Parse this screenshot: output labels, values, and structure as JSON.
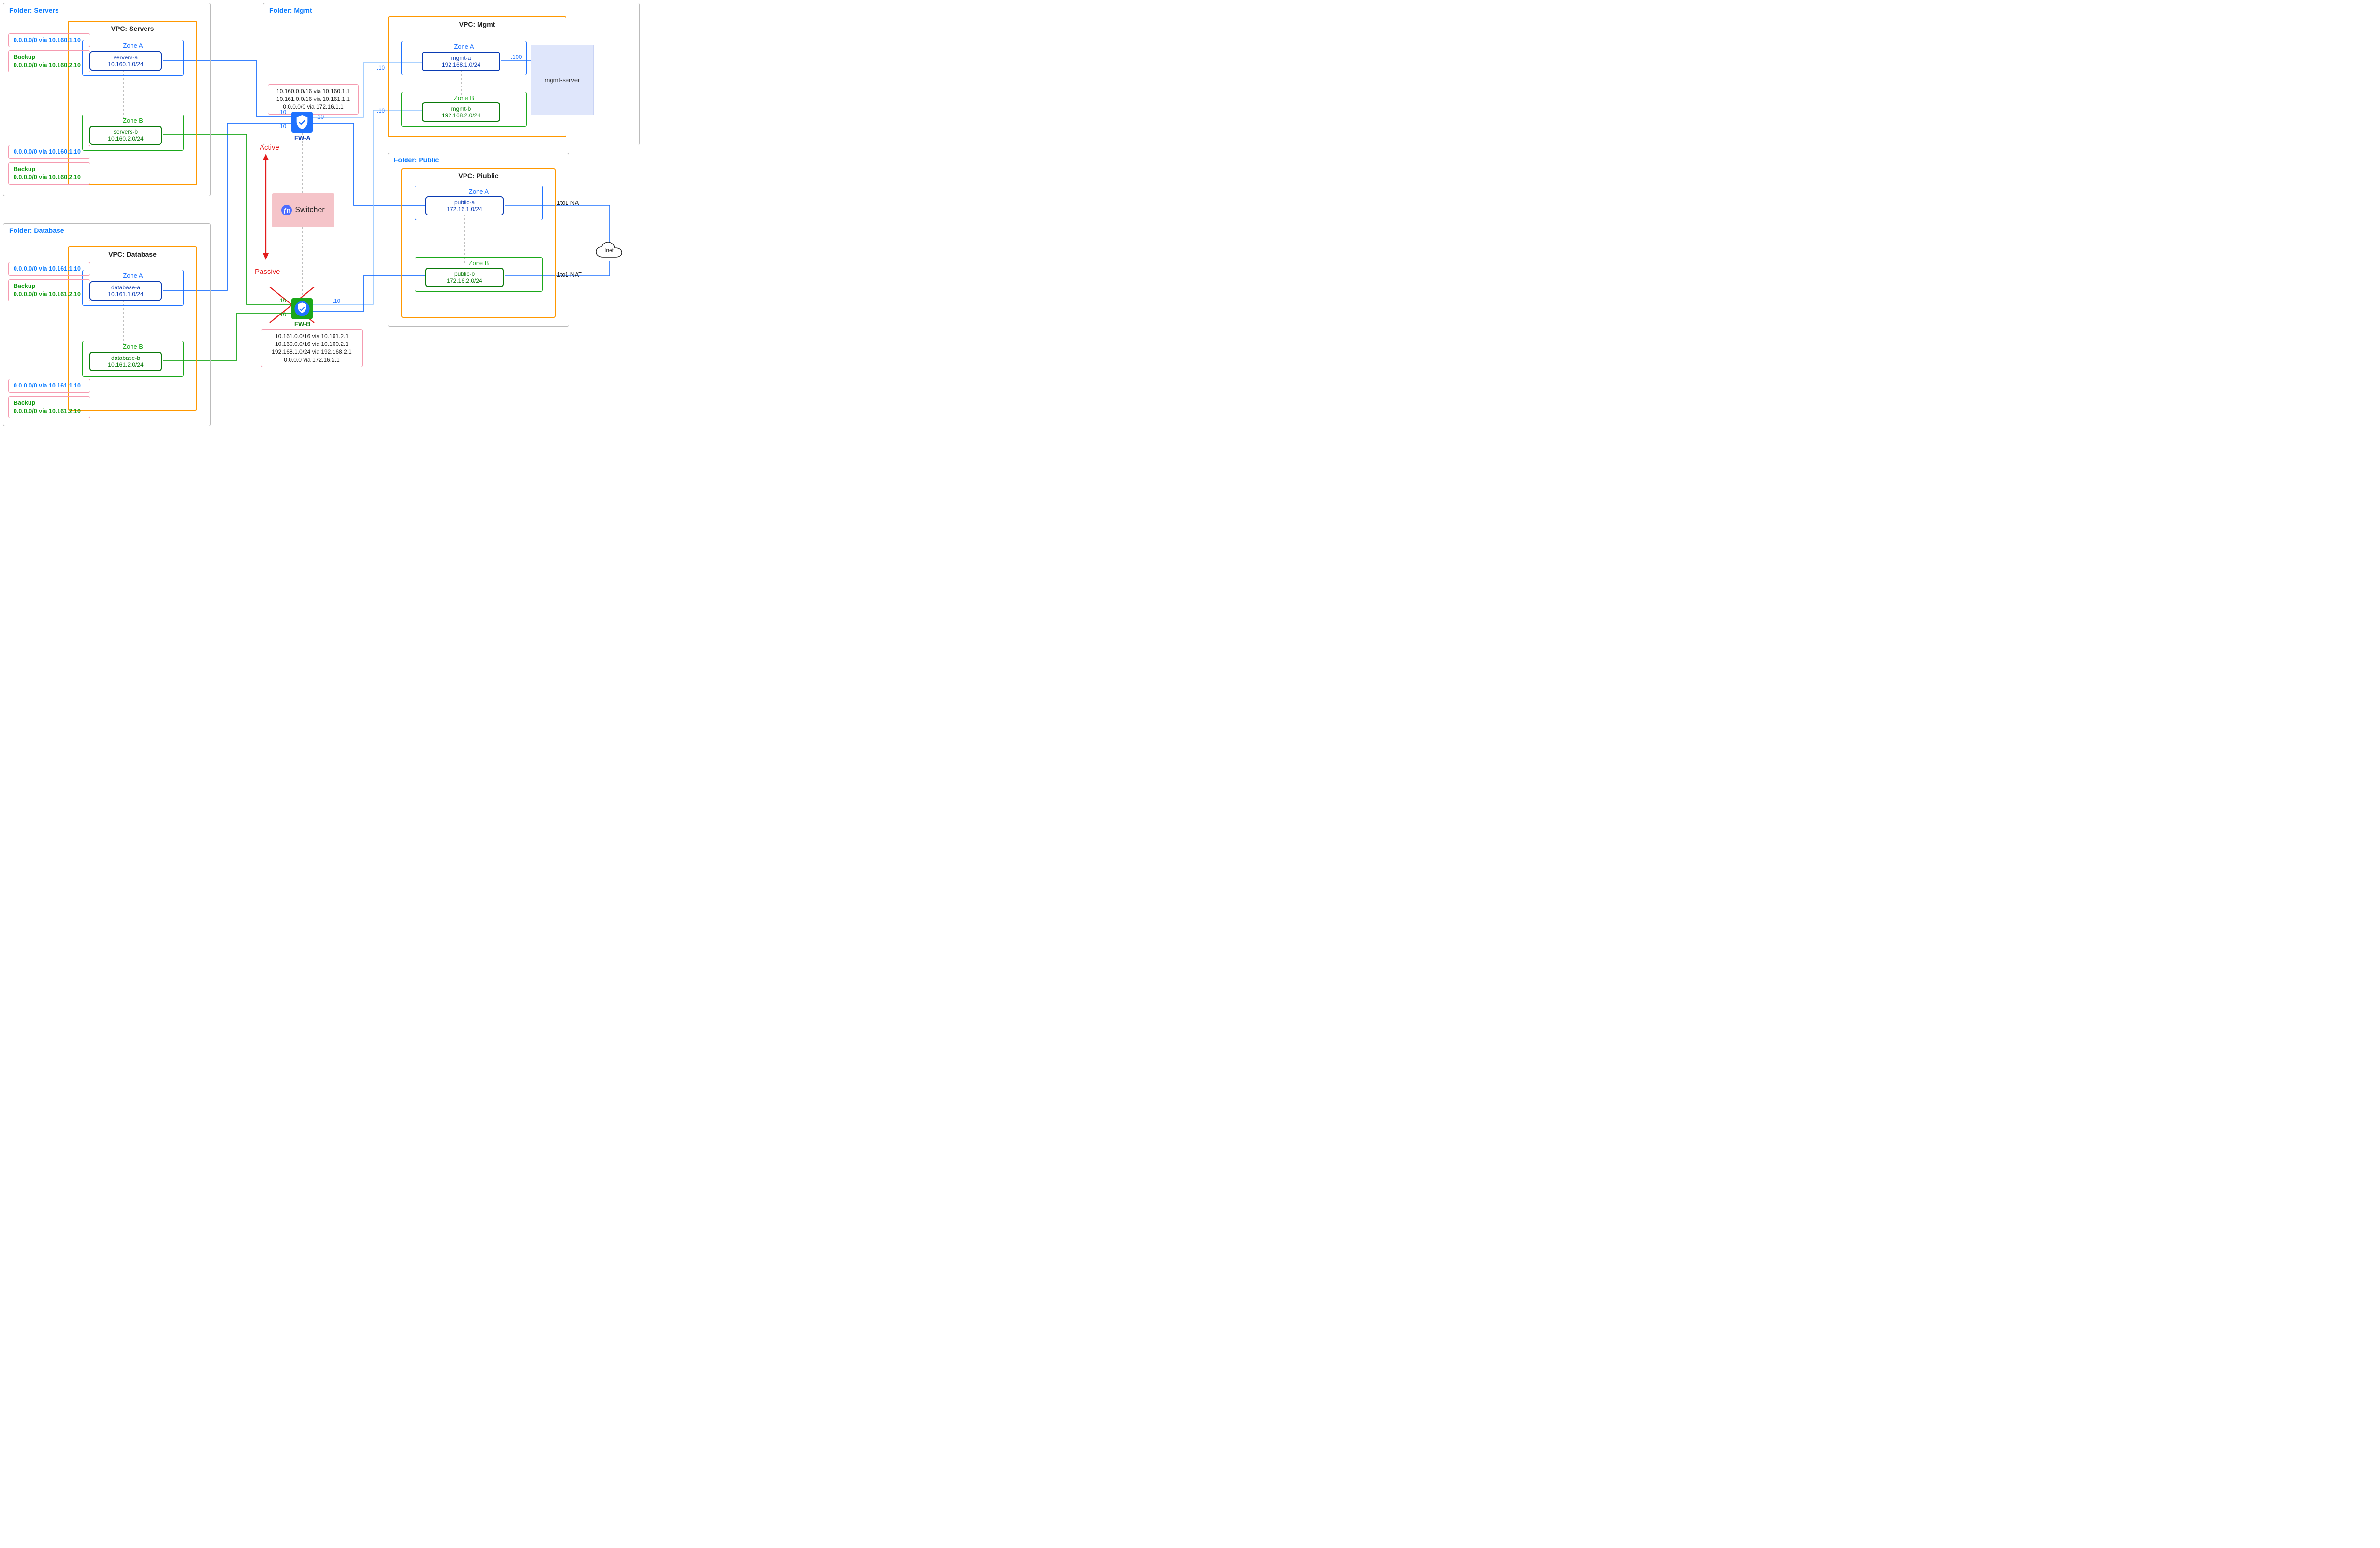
{
  "folders": {
    "servers": {
      "title": "Folder: Servers",
      "vpc_title": "VPC: Servers",
      "zoneA": "Zone A",
      "zoneB": "Zone B",
      "subnetA": {
        "name": "servers-a",
        "cidr": "10.160.1.0/24"
      },
      "subnetB": {
        "name": "servers-b",
        "cidr": "10.160.2.0/24"
      },
      "route1_primary": "0.0.0.0/0 via 10.160.1.10",
      "route1_backup_label": "Backup",
      "route1_backup": "0.0.0.0/0 via 10.160.2.10",
      "route2_primary": "0.0.0.0/0 via 10.160.1.10",
      "route2_backup_label": "Backup",
      "route2_backup": "0.0.0.0/0 via 10.160.2.10"
    },
    "database": {
      "title": "Folder: Database",
      "vpc_title": "VPC: Database",
      "zoneA": "Zone A",
      "zoneB": "Zone B",
      "subnetA": {
        "name": "database-a",
        "cidr": "10.161.1.0/24"
      },
      "subnetB": {
        "name": "database-b",
        "cidr": "10.161.2.0/24"
      },
      "route1_primary": "0.0.0.0/0 via 10.161.1.10",
      "route1_backup_label": "Backup",
      "route1_backup": "0.0.0.0/0 via 10.161.2.10",
      "route2_primary": "0.0.0.0/0 via 10.161.1.10",
      "route2_backup_label": "Backup",
      "route2_backup": "0.0.0.0/0 via 10.161.2.10"
    },
    "mgmt": {
      "title": "Folder: Mgmt",
      "vpc_title": "VPC: Mgmt",
      "zoneA": "Zone A",
      "zoneB": "Zone B",
      "subnetA": {
        "name": "mgmt-a",
        "cidr": "192.168.1.0/24"
      },
      "subnetB": {
        "name": "mgmt-b",
        "cidr": "192.168.2.0/24"
      },
      "mgmt_server": "mgmt-server"
    },
    "public": {
      "title": "Folder: Public",
      "vpc_title": "VPC: Piublic",
      "zoneA": "Zone A",
      "zoneB": "Zone B",
      "subnetA": {
        "name": "public-a",
        "cidr": "172.16.1.0/24"
      },
      "subnetB": {
        "name": "public-b",
        "cidr": "172.16.2.0/24"
      }
    }
  },
  "fw": {
    "a": {
      "label": "FW-A",
      "status": "Active",
      "routes": [
        "10.160.0.0/16 via 10.160.1.1",
        "10.161.0.0/16 via 10.161.1.1",
        "0.0.0.0/0 via 172.16.1.1"
      ]
    },
    "b": {
      "label": "FW-B",
      "status": "Passive",
      "routes": [
        "10.161.0.0/16 via 10.161.2.1",
        "10.160.0.0/16 via  10.160.2.1",
        "192.168.1.0/24 via 192.168.2.1",
        "0.0.0.0 via 172.16.2.1"
      ]
    }
  },
  "switcher": "Switcher",
  "ips": {
    "fwA_left1": ".10",
    "fwA_left2": ".10",
    "fwA_right1": ".10",
    "fwA_mgmt_right": ".10",
    "fwB_left1": ".10",
    "fwB_left2": ".10",
    "fwB_right1": ".10",
    "fwB_mgmt_right": ".10",
    "mgmt_srv": ".100"
  },
  "nat": {
    "a": "1to1 NAT",
    "b": "1to1 NAT"
  },
  "inet": "Inet"
}
